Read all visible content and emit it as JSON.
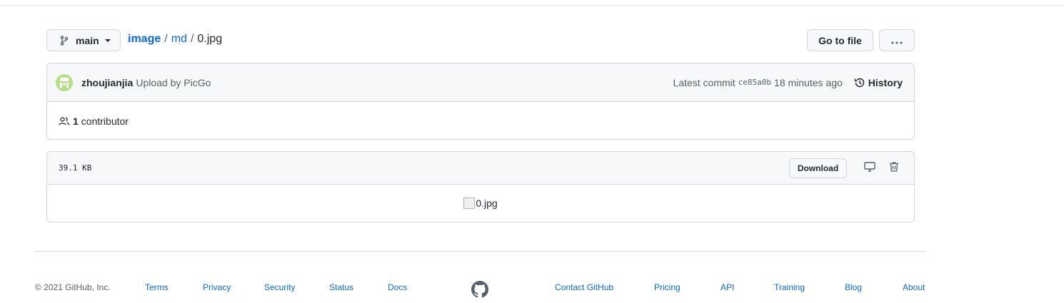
{
  "header": {
    "branch": "main",
    "breadcrumb": {
      "root": "image",
      "folder": "md",
      "file": "0.jpg",
      "separator": "/"
    },
    "goto_file_label": "Go to file",
    "more_label": "···"
  },
  "commit": {
    "author": "zhoujianjia",
    "message": "Upload by PicGo",
    "latest_label": "Latest commit",
    "sha": "ce85a0b",
    "time": "18 minutes ago",
    "history_label": "History",
    "contributor_count": "1",
    "contributor_label": "contributor"
  },
  "file": {
    "size": "39.1 KB",
    "download_label": "Download",
    "image_alt": "0.jpg"
  },
  "footer": {
    "copyright": "© 2021 GitHub, Inc.",
    "links_left": [
      "Terms",
      "Privacy",
      "Security",
      "Status",
      "Docs"
    ],
    "links_right": [
      "Contact GitHub",
      "Pricing",
      "API",
      "Training",
      "Blog",
      "About"
    ]
  },
  "colors": {
    "link": "#0969da",
    "border": "#d0d7de",
    "header_bg": "#f6f8fa",
    "avatar": "#b8e08a"
  }
}
